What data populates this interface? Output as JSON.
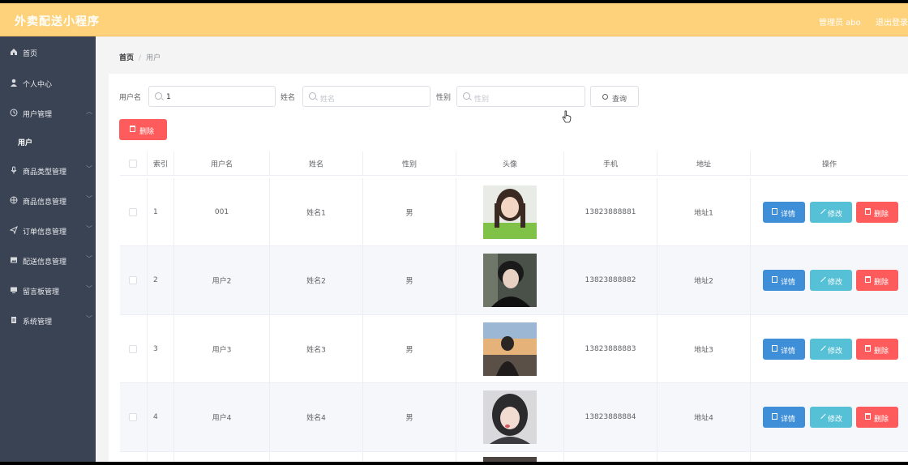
{
  "app": {
    "title": "外卖配送小程序",
    "admin": "管理员 abo",
    "logout": "退出登录"
  },
  "sidebar": {
    "items": [
      {
        "label": "首页",
        "icon": "home-icon"
      },
      {
        "label": "个人中心",
        "icon": "user-icon"
      },
      {
        "label": "用户管理",
        "icon": "clock-icon",
        "expanded": true,
        "sub": [
          "用户"
        ]
      },
      {
        "label": "商品类型管理",
        "icon": "mic-icon"
      },
      {
        "label": "商品信息管理",
        "icon": "globe-icon"
      },
      {
        "label": "订单信息管理",
        "icon": "send-icon"
      },
      {
        "label": "配送信息管理",
        "icon": "picture-icon"
      },
      {
        "label": "留言板管理",
        "icon": "monitor-icon"
      },
      {
        "label": "系统管理",
        "icon": "document-icon"
      }
    ]
  },
  "breadcrumb": {
    "home": "首页",
    "separator": "/",
    "current": "用户"
  },
  "search": {
    "username_label": "用户名",
    "username_value": "1",
    "name_label": "姓名",
    "name_placeholder": "姓名",
    "gender_label": "性别",
    "gender_placeholder": "性别",
    "query_button": "查询"
  },
  "toolbar": {
    "delete_button": "删除"
  },
  "table": {
    "columns": [
      "索引",
      "用户名",
      "姓名",
      "性别",
      "头像",
      "手机",
      "地址",
      "操作"
    ],
    "rows": [
      {
        "index": "1",
        "username": "001",
        "name": "姓名1",
        "gender": "男",
        "phone": "13823888881",
        "address": "地址1"
      },
      {
        "index": "2",
        "username": "用户2",
        "name": "姓名2",
        "gender": "男",
        "phone": "13823888882",
        "address": "地址2"
      },
      {
        "index": "3",
        "username": "用户3",
        "name": "姓名3",
        "gender": "男",
        "phone": "13823888883",
        "address": "地址3"
      },
      {
        "index": "4",
        "username": "用户4",
        "name": "姓名4",
        "gender": "男",
        "phone": "13823888884",
        "address": "地址4"
      }
    ],
    "actions": {
      "detail": "详情",
      "edit": "修改",
      "delete": "删除"
    }
  },
  "colors": {
    "header": "#fdd27a",
    "sidebar": "#3a4353",
    "primary": "#3e8fd8",
    "info": "#56c0d7",
    "danger": "#fe5c5c"
  }
}
